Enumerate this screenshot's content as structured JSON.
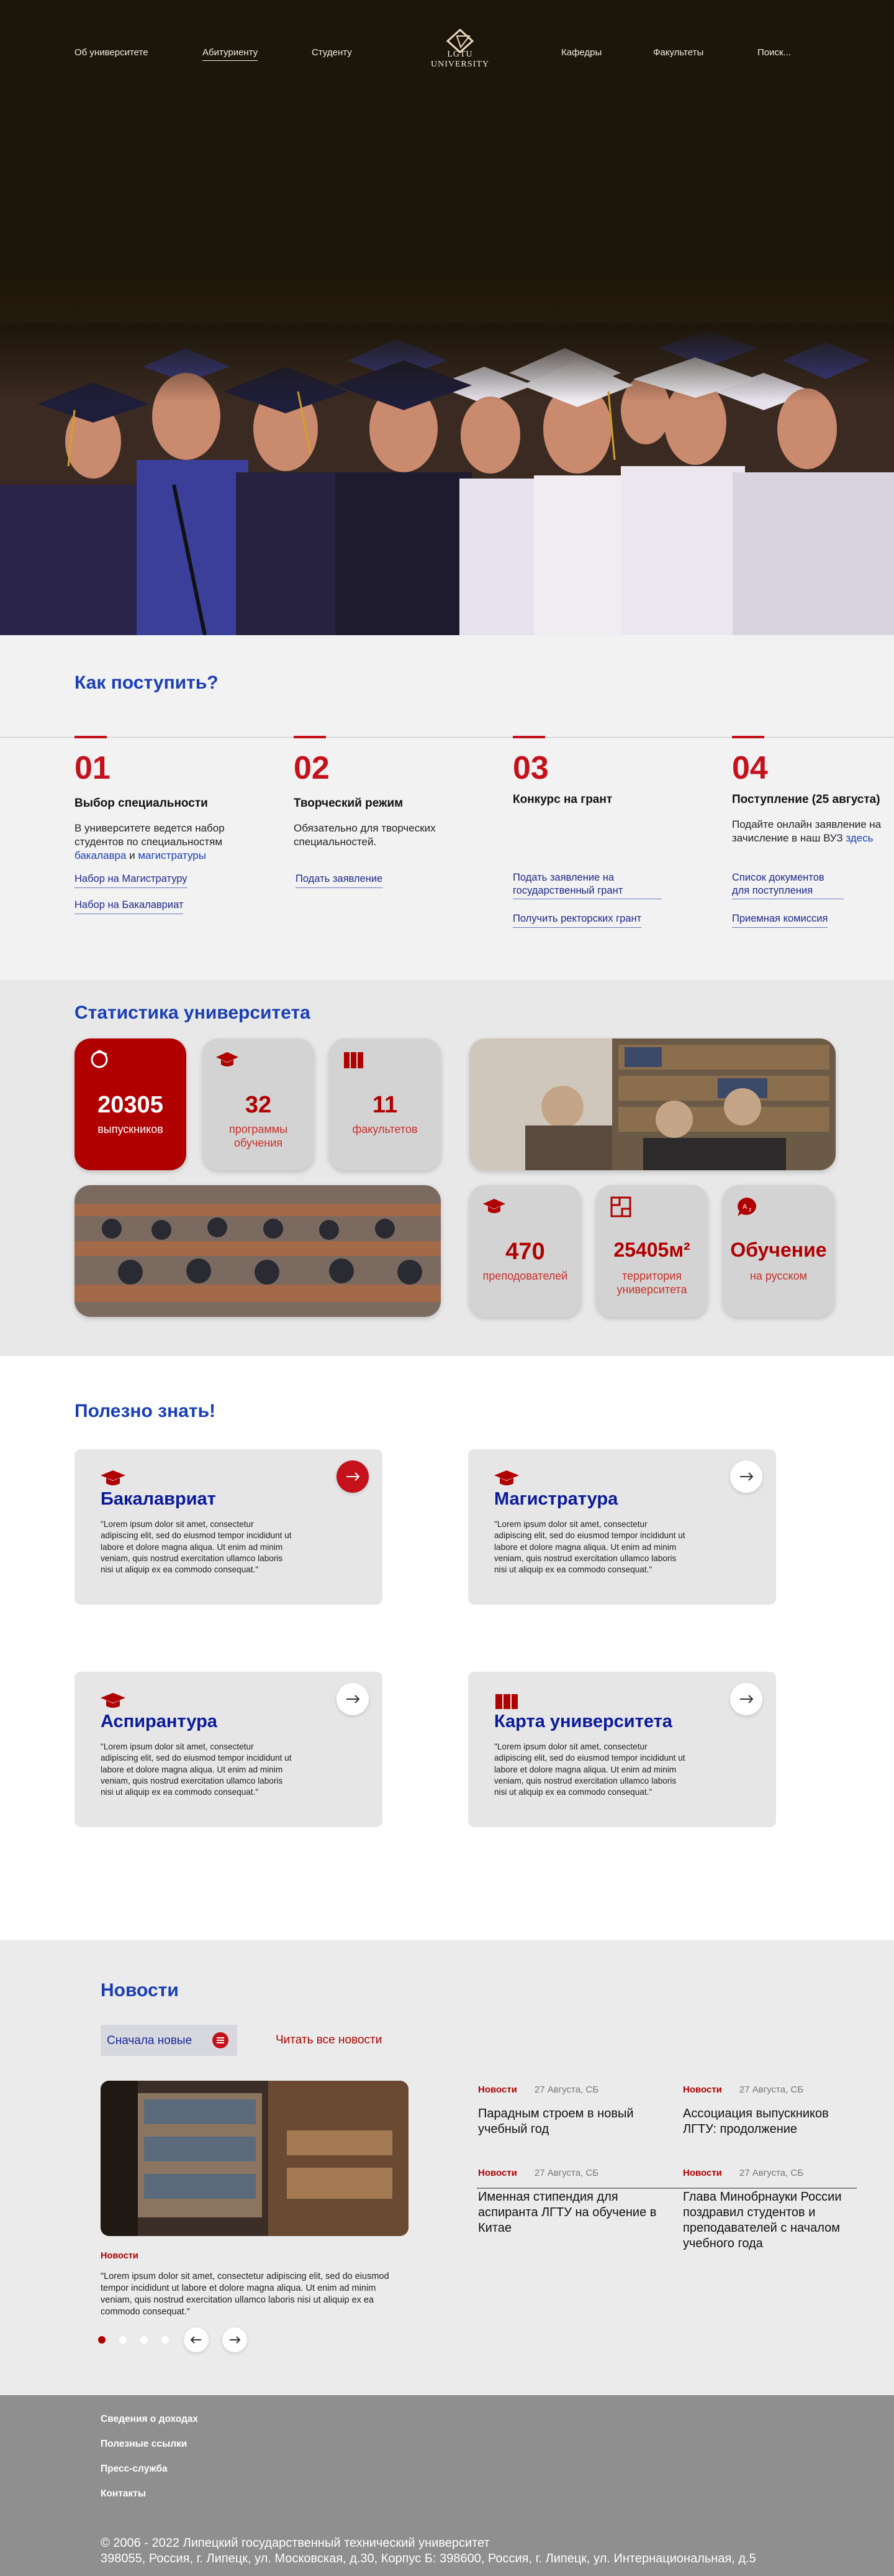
{
  "nav": {
    "left": [
      "Об университете",
      "Абитуриенту",
      "Студенту"
    ],
    "right": [
      "Кафедры",
      "Факультеты",
      "Поиск..."
    ],
    "logo_text": "LGTU UNIVERSITY"
  },
  "apply": {
    "title": "Как поступить?",
    "steps": [
      {
        "num": "01",
        "title": "Выбор специальности",
        "desc_plain": "В университете ведется набор студентов по специальностям",
        "desc_link1": "бакалавра",
        "desc_and": " и ",
        "desc_link2": "магистратуры",
        "links": [
          "Набор на Магистратуру",
          "Набор на Бакалавриат"
        ]
      },
      {
        "num": "02",
        "title": "Творческий режим",
        "desc_plain": "Обязательно для творческих специальностей.",
        "links": [
          "Подать заявление"
        ]
      },
      {
        "num": "03",
        "title": "Конкурс на грант",
        "links": [
          "Подать заявление на государственный грант",
          "Получить ректорских грант"
        ]
      },
      {
        "num": "04",
        "title": "Поступление (25 августа)",
        "desc_plain": "Подайте онлайн заявление на зачисление в наш ВУЗ",
        "desc_link1": "здесь",
        "links": [
          "Список документов для поступления",
          "Приемная комиссия"
        ]
      }
    ]
  },
  "stats": {
    "title": "Статистика университета",
    "cards": [
      {
        "value": "20305",
        "label": "выпускников",
        "icon": "award-icon"
      },
      {
        "value": "32",
        "label": "программы обучения",
        "icon": "graduation-cap-icon"
      },
      {
        "value": "11",
        "label": "факультетов",
        "icon": "books-icon"
      },
      {
        "value": "470",
        "label": "преподователей",
        "icon": "graduation-cap-icon"
      },
      {
        "value": "25405м²",
        "label": "территория университета",
        "icon": "floorplan-icon"
      },
      {
        "value": "Обучение",
        "label": "на русском",
        "icon": "language-icon"
      }
    ]
  },
  "useful": {
    "title": "Полезно знать!",
    "lorem": "\"Lorem ipsum dolor sit amet, consectetur adipiscing elit, sed do eiusmod tempor incididunt ut labore et dolore magna aliqua. Ut enim ad minim veniam, quis nostrud exercitation ullamco laboris nisi ut aliquip ex ea commodo consequat.\"",
    "cards": [
      {
        "title": "Бакалавриат"
      },
      {
        "title": "Магистратура"
      },
      {
        "title": "Аспирантура"
      },
      {
        "title": "Карта университета"
      }
    ]
  },
  "news": {
    "title": "Новости",
    "sort_label": "Сначала новые",
    "all_label": "Читать все новости",
    "featured_tag": "Новости",
    "featured_text": "\"Lorem ipsum dolor sit amet, consectetur adipiscing elit, sed do eiusmod tempor incididunt ut labore et dolore magna aliqua. Ut enim ad minim veniam, quis nostrud exercitation ullamco laboris nisi ut aliquip ex ea commodo consequat.\"",
    "prev": "←",
    "next": "→",
    "items": [
      {
        "tag": "Новости",
        "date": "27 Августа, СБ",
        "headline": "Парадным строем в новый учебный год"
      },
      {
        "tag": "Новости",
        "date": "27 Августа, СБ",
        "headline": "Ассоциация выпускников ЛГТУ: продолжение"
      },
      {
        "tag": "Новости",
        "date": "27 Августа, СБ",
        "headline": "Именная стипендия для аспиранта ЛГТУ на обучение в Китае"
      },
      {
        "tag": "Новости",
        "date": "27 Августа, СБ",
        "headline": "Глава Минобрнауки России поздравил студентов и преподавателей с началом учебного года"
      }
    ]
  },
  "footer": {
    "links": [
      "Сведения о доходах",
      "Полезные ссылки",
      "Пресс-служба",
      "Контакты"
    ],
    "copyright": "© 2006 - 2022 Липецкий государственный технический университет",
    "address": "398055, Россия, г. Липецк, ул. Московская, д.30, Корпус Б: 398600, Россия, г. Липецк, ул. Интернациональная, д.5"
  },
  "colors": {
    "accent": "#b00000",
    "link": "#1a3fb5",
    "title_blue": "#0a1a9a"
  }
}
